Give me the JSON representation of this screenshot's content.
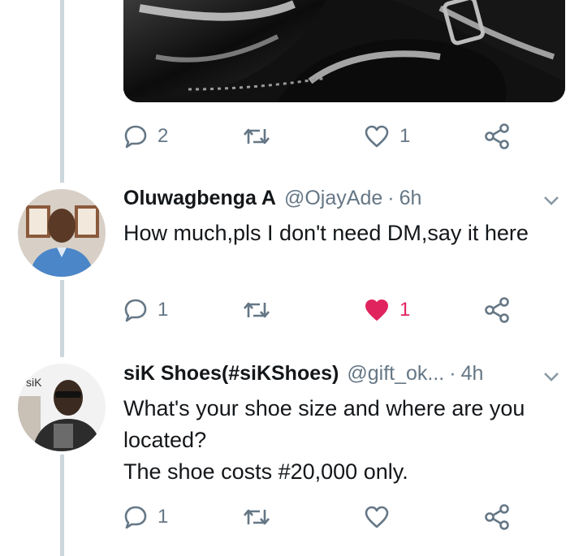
{
  "tweet_top": {
    "reply_count": "2",
    "like_count": "1"
  },
  "reply1": {
    "name": "Oluwagbenga A",
    "handle": "@OjayAde",
    "dot": "·",
    "time": "6h",
    "text": "How much,pls I don't need DM,say it here",
    "reply_count": "1",
    "like_count": "1",
    "liked": true
  },
  "reply2": {
    "name": "siK Shoes(#siKShoes)",
    "handle": "@gift_ok...",
    "dot": "·",
    "time": "4h",
    "text_lines": [
      "What's your shoe size and where are you",
      "located?",
      "The shoe costs #20,000 only."
    ],
    "reply_count": "1"
  },
  "colors": {
    "icon_gray": "#657786",
    "like_red": "#e0245e",
    "thread_line": "#ccd6dd"
  },
  "icons": [
    "reply-icon",
    "retweet-icon",
    "heart-icon",
    "share-icon",
    "chevron-down-icon"
  ]
}
